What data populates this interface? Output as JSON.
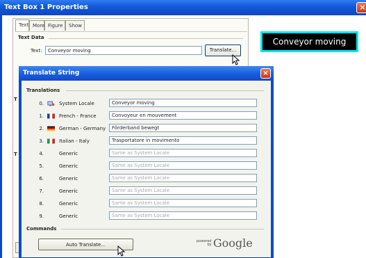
{
  "outer_window": {
    "title": "Text Box 1 Properties",
    "close_glyph": "×",
    "tabs": [
      "Text",
      "More",
      "Figure",
      "Show"
    ],
    "text_data_section": "Text Data",
    "text_label": "Text:",
    "text_value": "Conveyor moving",
    "translate_button": "Translate...",
    "side_letters": [
      "T",
      "T",
      "T"
    ]
  },
  "preview": {
    "text": "Conveyor moving",
    "border_color": "#00e5ee",
    "background": "#000000"
  },
  "dialog": {
    "title": "Translate String",
    "close_glyph": "×",
    "translations_section": "Translations",
    "rows": [
      {
        "num": "0.",
        "lang": "System Locale",
        "value": "Conveyor moving",
        "placeholder": false,
        "flag": "system-locale"
      },
      {
        "num": "1.",
        "lang": "French - France",
        "value": "Convoyeur en mouvement",
        "placeholder": false,
        "flag": "france"
      },
      {
        "num": "2.",
        "lang": "German - Germany",
        "value": "Förderband bewegt",
        "placeholder": false,
        "flag": "germany"
      },
      {
        "num": "3.",
        "lang": "Italian - Italy",
        "value": "Trasportatore in movimento",
        "placeholder": false,
        "flag": "italy"
      },
      {
        "num": "4.",
        "lang": "Generic",
        "value": "Same as System Locale",
        "placeholder": true,
        "flag": "none"
      },
      {
        "num": "5.",
        "lang": "Generic",
        "value": "Same as System Locale",
        "placeholder": true,
        "flag": "none"
      },
      {
        "num": "6.",
        "lang": "Generic",
        "value": "Same as System Locale",
        "placeholder": true,
        "flag": "none"
      },
      {
        "num": "7.",
        "lang": "Generic",
        "value": "Same as System Locale",
        "placeholder": true,
        "flag": "none"
      },
      {
        "num": "8.",
        "lang": "Generic",
        "value": "Same as System Locale",
        "placeholder": true,
        "flag": "none"
      },
      {
        "num": "9.",
        "lang": "Generic",
        "value": "Same as System Locale",
        "placeholder": true,
        "flag": "none"
      }
    ],
    "commands_section": "Commands",
    "auto_translate_button": "Auto Translate...",
    "powered_by": [
      "powered",
      "by"
    ],
    "google": "Google"
  },
  "colors": {
    "titlebar": "#1357d8",
    "screen_bg": "#ffff00"
  }
}
